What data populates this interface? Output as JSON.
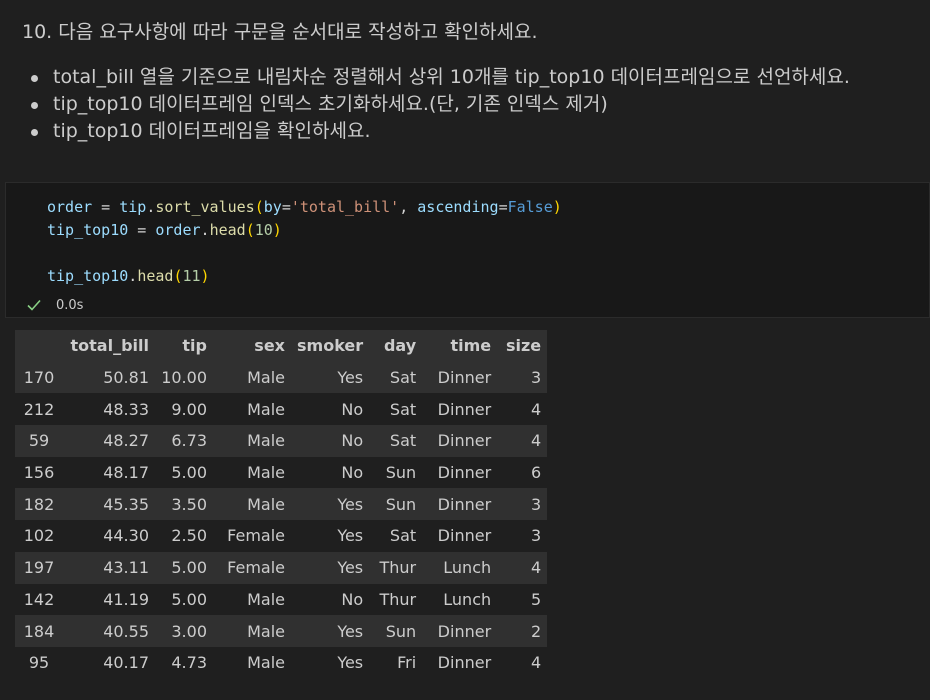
{
  "markdown": {
    "title": "10. 다음 요구사항에 따라 구문을 순서대로 작성하고 확인하세요.",
    "bullets": [
      "total_bill 열을 기준으로 내림차순 정렬해서 상위 10개를 tip_top10 데이터프레임으로 선언하세요.",
      "tip_top10 데이터프레임 인덱스 초기화하세요.(단, 기존 인덱스 제거)",
      "tip_top10 데이터프레임을 확인하세요."
    ]
  },
  "code": {
    "line1": {
      "var": "order",
      "eq": " = ",
      "obj": "tip",
      "dot": ".",
      "fn": "sort_values",
      "open": "(",
      "kw1": "by",
      "eq1": "=",
      "str1": "'total_bill'",
      "comma": ", ",
      "kw2": "ascending",
      "eq2": "=",
      "bool": "False",
      "close": ")"
    },
    "line2": {
      "var": "tip_top10",
      "eq": " = ",
      "obj": "order",
      "dot": ".",
      "fn": "head",
      "open": "(",
      "num": "10",
      "close": ")"
    },
    "line3": {
      "obj": "tip_top10",
      "dot": ".",
      "fn": "head",
      "open": "(",
      "num": "11",
      "close": ")"
    },
    "status": {
      "icon": "check-icon",
      "time": "0.0s"
    }
  },
  "table": {
    "columns": [
      "",
      "total_bill",
      "tip",
      "sex",
      "smoker",
      "day",
      "time",
      "size"
    ],
    "rows": [
      [
        "170",
        "50.81",
        "10.00",
        "Male",
        "Yes",
        "Sat",
        "Dinner",
        "3"
      ],
      [
        "212",
        "48.33",
        "9.00",
        "Male",
        "No",
        "Sat",
        "Dinner",
        "4"
      ],
      [
        "59",
        "48.27",
        "6.73",
        "Male",
        "No",
        "Sat",
        "Dinner",
        "4"
      ],
      [
        "156",
        "48.17",
        "5.00",
        "Male",
        "No",
        "Sun",
        "Dinner",
        "6"
      ],
      [
        "182",
        "45.35",
        "3.50",
        "Male",
        "Yes",
        "Sun",
        "Dinner",
        "3"
      ],
      [
        "102",
        "44.30",
        "2.50",
        "Female",
        "Yes",
        "Sat",
        "Dinner",
        "3"
      ],
      [
        "197",
        "43.11",
        "5.00",
        "Female",
        "Yes",
        "Thur",
        "Lunch",
        "4"
      ],
      [
        "142",
        "41.19",
        "5.00",
        "Male",
        "No",
        "Thur",
        "Lunch",
        "5"
      ],
      [
        "184",
        "40.55",
        "3.00",
        "Male",
        "Yes",
        "Sun",
        "Dinner",
        "2"
      ],
      [
        "95",
        "40.17",
        "4.73",
        "Male",
        "Yes",
        "Fri",
        "Dinner",
        "4"
      ]
    ]
  },
  "colors": {
    "background": "#1f1f1f",
    "code_bg": "#181818",
    "check": "#89d185",
    "row_stripe": "#303030"
  }
}
